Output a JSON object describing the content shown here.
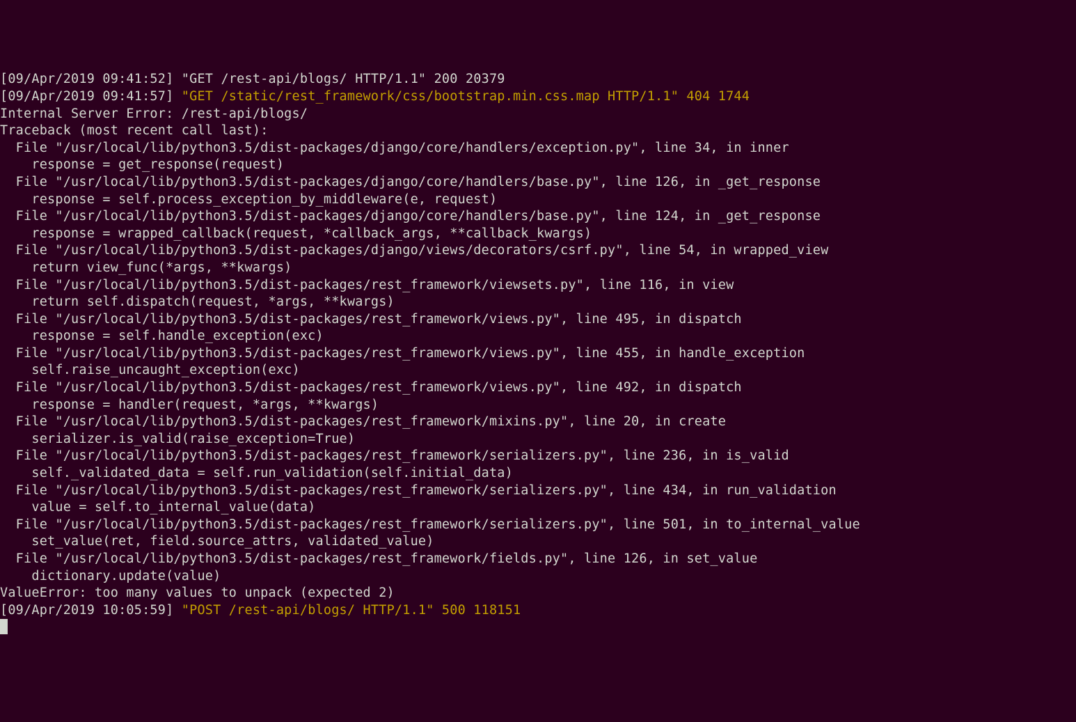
{
  "terminal": {
    "lines": [
      {
        "cls": "line",
        "text": "[09/Apr/2019 09:41:52] \"GET /rest-api/blogs/ HTTP/1.1\" 200 20379"
      },
      {
        "cls": "line",
        "prefix": "[09/Apr/2019 09:41:57] ",
        "highlight": "\"GET /static/rest_framework/css/bootstrap.min.css.map HTTP/1.1\" 404 1744"
      },
      {
        "cls": "line",
        "text": "Internal Server Error: /rest-api/blogs/"
      },
      {
        "cls": "line",
        "text": "Traceback (most recent call last):"
      },
      {
        "cls": "line",
        "text": "  File \"/usr/local/lib/python3.5/dist-packages/django/core/handlers/exception.py\", line 34, in inner"
      },
      {
        "cls": "line",
        "text": "    response = get_response(request)"
      },
      {
        "cls": "line",
        "text": "  File \"/usr/local/lib/python3.5/dist-packages/django/core/handlers/base.py\", line 126, in _get_response"
      },
      {
        "cls": "line",
        "text": "    response = self.process_exception_by_middleware(e, request)"
      },
      {
        "cls": "line",
        "text": "  File \"/usr/local/lib/python3.5/dist-packages/django/core/handlers/base.py\", line 124, in _get_response"
      },
      {
        "cls": "line",
        "text": "    response = wrapped_callback(request, *callback_args, **callback_kwargs)"
      },
      {
        "cls": "line",
        "text": "  File \"/usr/local/lib/python3.5/dist-packages/django/views/decorators/csrf.py\", line 54, in wrapped_view"
      },
      {
        "cls": "line",
        "text": "    return view_func(*args, **kwargs)"
      },
      {
        "cls": "line",
        "text": "  File \"/usr/local/lib/python3.5/dist-packages/rest_framework/viewsets.py\", line 116, in view"
      },
      {
        "cls": "line",
        "text": "    return self.dispatch(request, *args, **kwargs)"
      },
      {
        "cls": "line",
        "text": "  File \"/usr/local/lib/python3.5/dist-packages/rest_framework/views.py\", line 495, in dispatch"
      },
      {
        "cls": "line",
        "text": "    response = self.handle_exception(exc)"
      },
      {
        "cls": "line",
        "text": "  File \"/usr/local/lib/python3.5/dist-packages/rest_framework/views.py\", line 455, in handle_exception"
      },
      {
        "cls": "line",
        "text": "    self.raise_uncaught_exception(exc)"
      },
      {
        "cls": "line",
        "text": "  File \"/usr/local/lib/python3.5/dist-packages/rest_framework/views.py\", line 492, in dispatch"
      },
      {
        "cls": "line",
        "text": "    response = handler(request, *args, **kwargs)"
      },
      {
        "cls": "line",
        "text": "  File \"/usr/local/lib/python3.5/dist-packages/rest_framework/mixins.py\", line 20, in create"
      },
      {
        "cls": "line",
        "text": "    serializer.is_valid(raise_exception=True)"
      },
      {
        "cls": "line",
        "text": "  File \"/usr/local/lib/python3.5/dist-packages/rest_framework/serializers.py\", line 236, in is_valid"
      },
      {
        "cls": "line",
        "text": "    self._validated_data = self.run_validation(self.initial_data)"
      },
      {
        "cls": "line",
        "text": "  File \"/usr/local/lib/python3.5/dist-packages/rest_framework/serializers.py\", line 434, in run_validation"
      },
      {
        "cls": "line",
        "text": "    value = self.to_internal_value(data)"
      },
      {
        "cls": "line",
        "text": "  File \"/usr/local/lib/python3.5/dist-packages/rest_framework/serializers.py\", line 501, in to_internal_value"
      },
      {
        "cls": "line",
        "text": "    set_value(ret, field.source_attrs, validated_value)"
      },
      {
        "cls": "line",
        "text": "  File \"/usr/local/lib/python3.5/dist-packages/rest_framework/fields.py\", line 126, in set_value"
      },
      {
        "cls": "line",
        "text": "    dictionary.update(value)"
      },
      {
        "cls": "line",
        "text": "ValueError: too many values to unpack (expected 2)"
      },
      {
        "cls": "line",
        "prefix": "[09/Apr/2019 10:05:59] ",
        "highlight": "\"POST /rest-api/blogs/ HTTP/1.1\" 500 118151"
      }
    ]
  }
}
